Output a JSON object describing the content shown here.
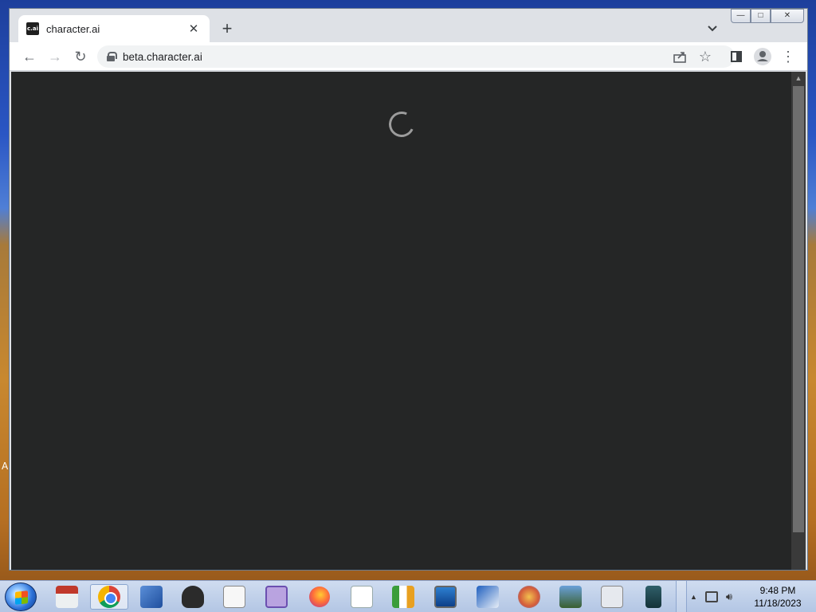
{
  "desktop": {
    "edge_letter": "A"
  },
  "window": {
    "controls": {
      "minimize": "—",
      "maximize": "□",
      "close": "✕"
    },
    "tab": {
      "favicon_text": "c.ai",
      "title": "character.ai",
      "close": "✕"
    },
    "new_tab": "+",
    "tab_search_icon": "chevron-down-icon"
  },
  "toolbar": {
    "back": "←",
    "forward": "→",
    "reload": "↻",
    "url": "beta.character.ai",
    "share_icon": "share-icon",
    "bookmark": "☆",
    "side_panel_icon": "side-panel-icon",
    "profile_icon": "profile-icon",
    "menu": "⋮"
  },
  "page": {
    "state": "loading",
    "background": "#252626"
  },
  "taskbar": {
    "apps": [
      "store-icon",
      "chrome-icon",
      "tool-icon",
      "hat-icon",
      "solitaire-icon",
      "disk-icon",
      "firefox-icon",
      "document-icon",
      "hxd-icon",
      "monitor-icon",
      "network-icon",
      "paint-icon",
      "photos-icon",
      "fax-icon",
      "phone-icon"
    ],
    "active_app": "chrome-icon",
    "clock": {
      "time": "9:48 PM",
      "date": "11/18/2023"
    }
  }
}
